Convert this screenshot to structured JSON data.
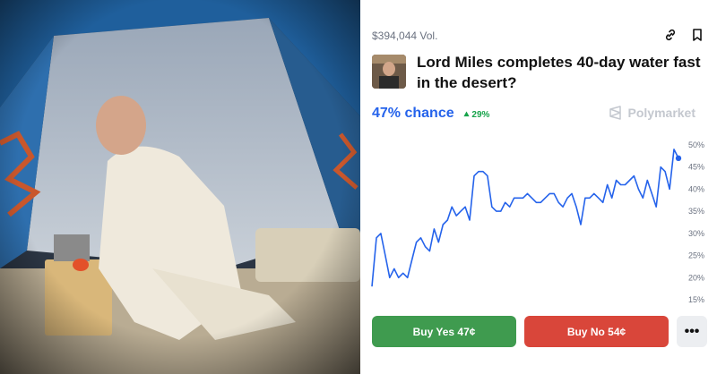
{
  "market": {
    "volume": "$394,044 Vol.",
    "title": "Lord Miles completes 40-day water fast in the desert?",
    "chance": "47% chance",
    "change": "29%",
    "brand": "Polymarket"
  },
  "buttons": {
    "yes": "Buy Yes 47¢",
    "no": "Buy No 54¢",
    "more": "•••"
  },
  "icons": {
    "link": "link-icon",
    "bookmark": "bookmark-icon",
    "change_arrow": "triangle-up-icon",
    "brand_logo": "polymarket-logo-icon"
  },
  "colors": {
    "accent": "#2563eb",
    "positive": "#16a34a",
    "yes": "#3f9b4f",
    "no": "#d9463a"
  },
  "chart_data": {
    "type": "line",
    "y_ticks": [
      "50%",
      "45%",
      "40%",
      "35%",
      "30%",
      "25%",
      "20%",
      "15%"
    ],
    "ylim": [
      15,
      50
    ],
    "x": [
      0,
      1,
      2,
      3,
      4,
      5,
      6,
      7,
      8,
      9,
      10,
      11,
      12,
      13,
      14,
      15,
      16,
      17,
      18,
      19,
      20,
      21,
      22,
      23,
      24,
      25,
      26,
      27,
      28,
      29,
      30,
      31,
      32,
      33,
      34,
      35,
      36,
      37,
      38,
      39,
      40,
      41,
      42,
      43,
      44,
      45,
      46,
      47,
      48,
      49,
      50,
      51,
      52,
      53,
      54,
      55,
      56,
      57,
      58,
      59,
      60,
      61,
      62,
      63,
      64,
      65,
      66,
      67,
      68,
      69
    ],
    "values": [
      18,
      29,
      30,
      25,
      20,
      22,
      20,
      21,
      20,
      24,
      28,
      29,
      27,
      26,
      31,
      28,
      32,
      33,
      36,
      34,
      35,
      36,
      33,
      43,
      44,
      44,
      43,
      36,
      35,
      35,
      37,
      36,
      38,
      38,
      38,
      39,
      38,
      37,
      37,
      38,
      39,
      39,
      37,
      36,
      38,
      39,
      36,
      32,
      38,
      38,
      39,
      38,
      37,
      41,
      38,
      42,
      41,
      41,
      42,
      43,
      40,
      38,
      42,
      39,
      36,
      45,
      44,
      40,
      49,
      47
    ],
    "last_value": 47,
    "series": [
      {
        "values": []
      }
    ]
  }
}
